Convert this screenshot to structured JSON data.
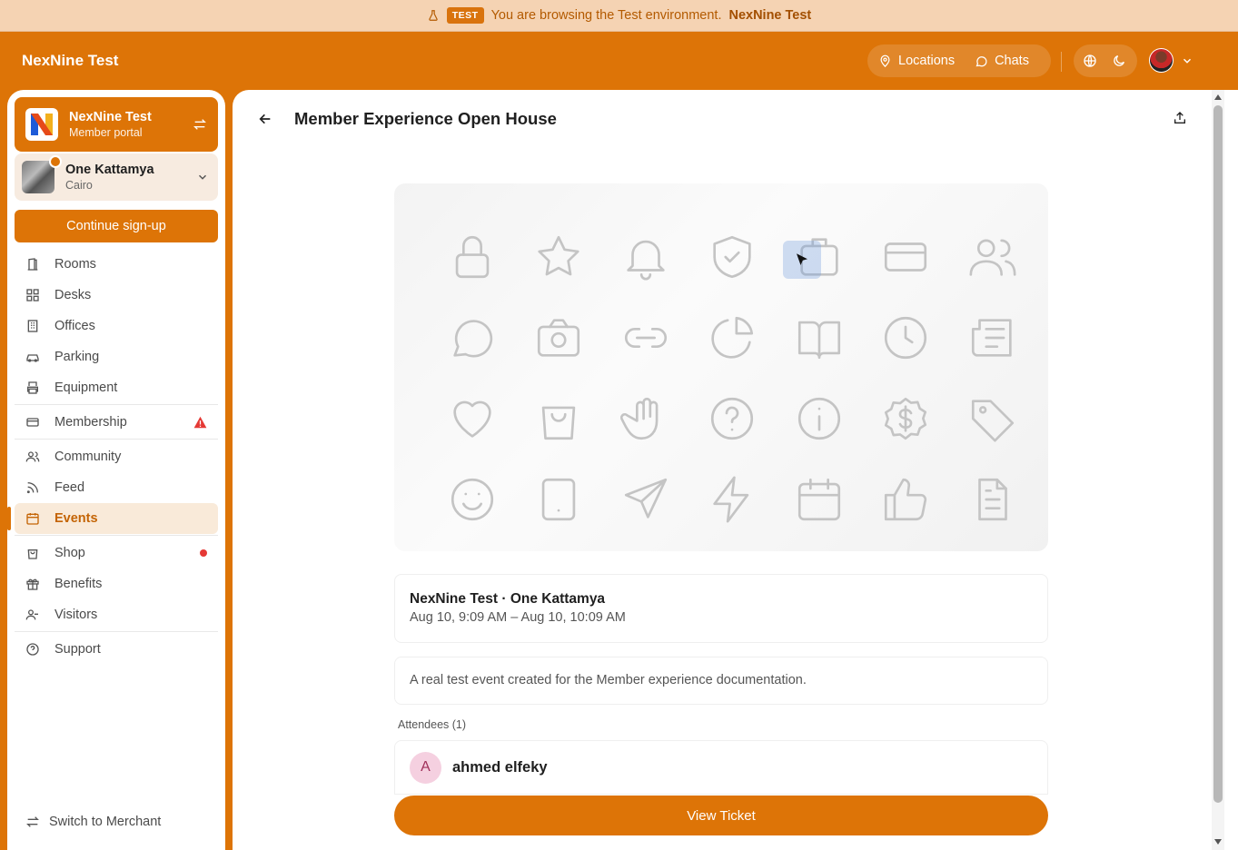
{
  "banner": {
    "badge": "TEST",
    "message": "You are browsing the Test environment.",
    "env_name": "NexNine Test"
  },
  "header": {
    "brand": "NexNine Test",
    "nav": [
      {
        "label": "Locations",
        "icon": "map-pin-icon"
      },
      {
        "label": "Chats",
        "icon": "chat-icon"
      }
    ],
    "tools": [
      "globe-icon",
      "moon-icon"
    ]
  },
  "sidebar": {
    "org": {
      "name": "NexNine Test",
      "subtitle": "Member portal"
    },
    "location": {
      "name": "One Kattamya",
      "city": "Cairo"
    },
    "cta_label": "Continue sign-up",
    "items": [
      {
        "label": "Rooms",
        "icon": "door-icon"
      },
      {
        "label": "Desks",
        "icon": "grid-icon"
      },
      {
        "label": "Offices",
        "icon": "building-icon"
      },
      {
        "label": "Parking",
        "icon": "car-icon"
      },
      {
        "label": "Equipment",
        "icon": "printer-icon"
      },
      {
        "label": "Membership",
        "icon": "card-icon",
        "badge": "warning-icon"
      },
      {
        "label": "Community",
        "icon": "users-icon"
      },
      {
        "label": "Feed",
        "icon": "rss-icon"
      },
      {
        "label": "Events",
        "icon": "calendar-icon",
        "active": true
      },
      {
        "label": "Shop",
        "icon": "bag-icon",
        "badge": "red-dot"
      },
      {
        "label": "Benefits",
        "icon": "gift-icon"
      },
      {
        "label": "Visitors",
        "icon": "user-icon"
      },
      {
        "label": "Support",
        "icon": "help-icon"
      }
    ],
    "switch_label": "Switch to Merchant"
  },
  "event": {
    "title": "Member Experience Open House",
    "org_location": "NexNine Test · One Kattamya",
    "date_range": "Aug 10, 9:09 AM – Aug 10, 10:09 AM",
    "description": "A real test event created for the Member experience documentation.",
    "attendees_label": "Attendees (1)",
    "attendees": [
      {
        "initial": "A",
        "name": "ahmed elfeky"
      }
    ],
    "ticket_label": "View Ticket"
  },
  "cover_icons": [
    "lock-icon",
    "star-icon",
    "bell-icon",
    "shield-check-icon",
    "briefcase-icon",
    "credit-card-icon",
    "users-icon",
    "message-icon",
    "camera-icon",
    "link-icon",
    "pie-chart-icon",
    "book-open-icon",
    "clock-icon",
    "newspaper-icon",
    "heart-icon",
    "shopping-bag-icon",
    "hand-icon",
    "help-circle-icon",
    "info-icon",
    "badge-dollar-icon",
    "tag-icon",
    "smile-icon",
    "tablet-icon",
    "send-icon",
    "zap-icon",
    "calendar-icon",
    "thumbs-up-icon",
    "file-text-icon"
  ],
  "colors": {
    "accent": "#dd7407",
    "banner_bg": "#f5d3b3",
    "active_bg": "#f9ead9",
    "warning": "#e53935"
  }
}
